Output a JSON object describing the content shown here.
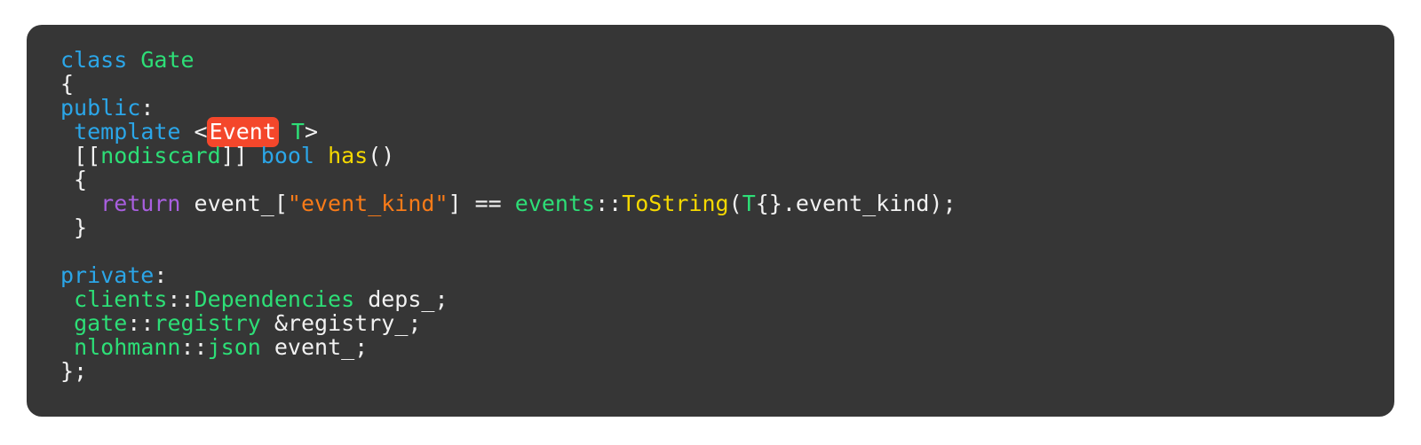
{
  "editor": {
    "language": "cpp",
    "card_background": "#363636",
    "page_background": "#ffffff",
    "highlight_color": "#f4472b",
    "highlight_text_color": "#ffffff",
    "colors": {
      "keyword": "#2ba6e8",
      "type": "#2ddf77",
      "function": "#f5d800",
      "control": "#a95fe0",
      "string": "#f97b18",
      "plain": "#f2f2f2"
    },
    "highlighted_token": "Event"
  },
  "code": {
    "lines": [
      {
        "index": 1,
        "text": "class Gate",
        "tokens": [
          {
            "text": "class",
            "kind": "keyword"
          },
          {
            "text": " ",
            "kind": "plain"
          },
          {
            "text": "Gate",
            "kind": "type"
          }
        ]
      },
      {
        "index": 2,
        "text": "{",
        "tokens": [
          {
            "text": "{",
            "kind": "plain"
          }
        ]
      },
      {
        "index": 3,
        "text": "public:",
        "tokens": [
          {
            "text": "public",
            "kind": "keyword"
          },
          {
            "text": ":",
            "kind": "plain"
          }
        ]
      },
      {
        "index": 4,
        "text": " template <Event T>",
        "tokens": [
          {
            "text": " ",
            "kind": "plain"
          },
          {
            "text": "template",
            "kind": "keyword"
          },
          {
            "text": " <",
            "kind": "plain"
          },
          {
            "text": "Event",
            "kind": "highlight"
          },
          {
            "text": " ",
            "kind": "plain"
          },
          {
            "text": "T",
            "kind": "type"
          },
          {
            "text": ">",
            "kind": "plain"
          }
        ]
      },
      {
        "index": 5,
        "text": " [[nodiscard]] bool has()",
        "tokens": [
          {
            "text": " [[",
            "kind": "plain"
          },
          {
            "text": "nodiscard",
            "kind": "type"
          },
          {
            "text": "]] ",
            "kind": "plain"
          },
          {
            "text": "bool",
            "kind": "keyword"
          },
          {
            "text": " ",
            "kind": "plain"
          },
          {
            "text": "has",
            "kind": "function"
          },
          {
            "text": "()",
            "kind": "plain"
          }
        ]
      },
      {
        "index": 6,
        "text": " {",
        "tokens": [
          {
            "text": " {",
            "kind": "plain"
          }
        ]
      },
      {
        "index": 7,
        "text": "   return event_[\"event_kind\"] == events::ToString(T{}.event_kind);",
        "tokens": [
          {
            "text": "   ",
            "kind": "plain"
          },
          {
            "text": "return",
            "kind": "control"
          },
          {
            "text": " event_[",
            "kind": "plain"
          },
          {
            "text": "\"event_kind\"",
            "kind": "string"
          },
          {
            "text": "] == ",
            "kind": "plain"
          },
          {
            "text": "events",
            "kind": "type"
          },
          {
            "text": "::",
            "kind": "plain"
          },
          {
            "text": "ToString",
            "kind": "function"
          },
          {
            "text": "(",
            "kind": "plain"
          },
          {
            "text": "T",
            "kind": "type"
          },
          {
            "text": "{}.event_kind);",
            "kind": "plain"
          }
        ]
      },
      {
        "index": 8,
        "text": " }",
        "tokens": [
          {
            "text": " }",
            "kind": "plain"
          }
        ]
      },
      {
        "index": 9,
        "text": "",
        "tokens": []
      },
      {
        "index": 10,
        "text": "private:",
        "tokens": [
          {
            "text": "private",
            "kind": "keyword"
          },
          {
            "text": ":",
            "kind": "plain"
          }
        ]
      },
      {
        "index": 11,
        "text": " clients::Dependencies deps_;",
        "tokens": [
          {
            "text": " ",
            "kind": "plain"
          },
          {
            "text": "clients",
            "kind": "type"
          },
          {
            "text": "::",
            "kind": "plain"
          },
          {
            "text": "Dependencies",
            "kind": "type"
          },
          {
            "text": " deps_;",
            "kind": "plain"
          }
        ]
      },
      {
        "index": 12,
        "text": " gate::registry &registry_;",
        "tokens": [
          {
            "text": " ",
            "kind": "plain"
          },
          {
            "text": "gate",
            "kind": "type"
          },
          {
            "text": "::",
            "kind": "plain"
          },
          {
            "text": "registry",
            "kind": "type"
          },
          {
            "text": " &registry_;",
            "kind": "plain"
          }
        ]
      },
      {
        "index": 13,
        "text": " nlohmann::json event_;",
        "tokens": [
          {
            "text": " ",
            "kind": "plain"
          },
          {
            "text": "nlohmann",
            "kind": "type"
          },
          {
            "text": "::",
            "kind": "plain"
          },
          {
            "text": "json",
            "kind": "type"
          },
          {
            "text": " event_;",
            "kind": "plain"
          }
        ]
      },
      {
        "index": 14,
        "text": "};",
        "tokens": [
          {
            "text": "};",
            "kind": "plain"
          }
        ]
      }
    ]
  }
}
